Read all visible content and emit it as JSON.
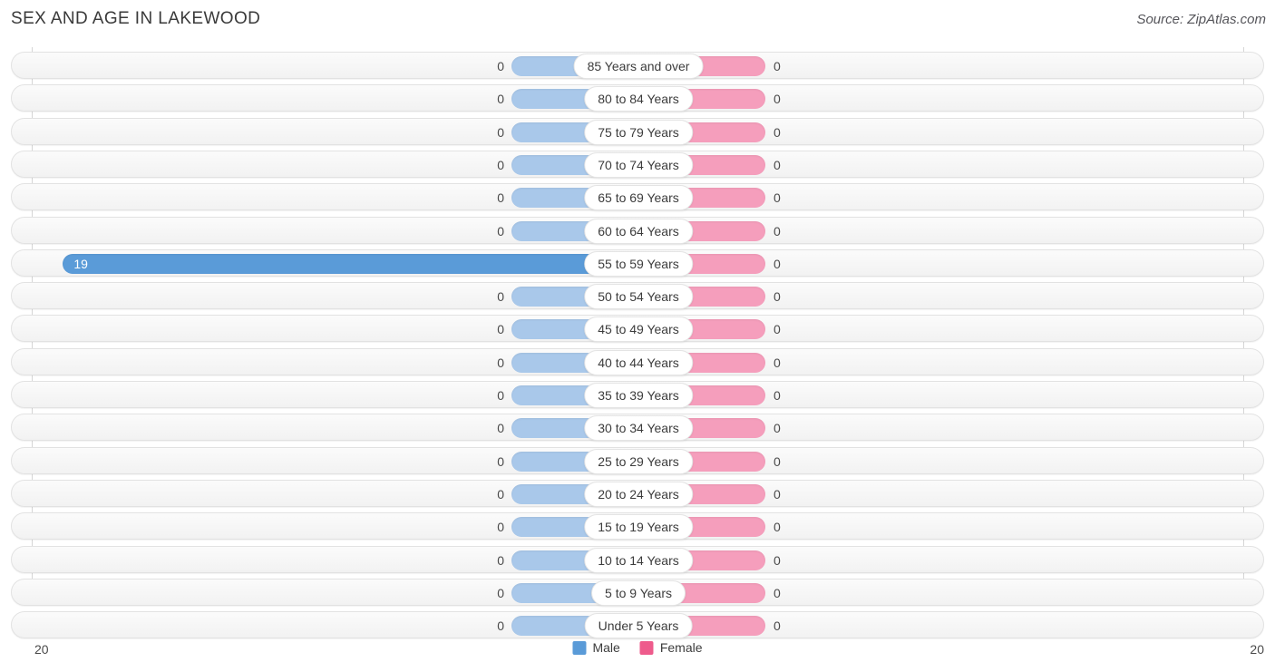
{
  "header": {
    "title": "SEX AND AGE IN LAKEWOOD",
    "source": "Source: ZipAtlas.com"
  },
  "legend": {
    "male_label": "Male",
    "female_label": "Female",
    "male_color": "#5a9bd8",
    "female_color": "#ee5b8c"
  },
  "axis": {
    "left_max_label": "20",
    "right_max_label": "20"
  },
  "chart_data": {
    "type": "bar",
    "subtype": "population-pyramid",
    "title": "SEX AND AGE IN LAKEWOOD",
    "source": "Source: ZipAtlas.com",
    "xlabel": "",
    "ylabel": "",
    "xlim": [
      20,
      20
    ],
    "axis_max": 20,
    "grid": false,
    "legend_position": "bottom-center",
    "categories": [
      "85 Years and over",
      "80 to 84 Years",
      "75 to 79 Years",
      "70 to 74 Years",
      "65 to 69 Years",
      "60 to 64 Years",
      "55 to 59 Years",
      "50 to 54 Years",
      "45 to 49 Years",
      "40 to 44 Years",
      "35 to 39 Years",
      "30 to 34 Years",
      "25 to 29 Years",
      "20 to 24 Years",
      "15 to 19 Years",
      "10 to 14 Years",
      "5 to 9 Years",
      "Under 5 Years"
    ],
    "series": [
      {
        "name": "Male",
        "color": "#5a9bd8",
        "direction": "left",
        "values": [
          0,
          0,
          0,
          0,
          0,
          0,
          19,
          0,
          0,
          0,
          0,
          0,
          0,
          0,
          0,
          0,
          0,
          0
        ]
      },
      {
        "name": "Female",
        "color": "#ee5b8c",
        "direction": "right",
        "values": [
          0,
          0,
          0,
          0,
          0,
          0,
          0,
          0,
          0,
          0,
          0,
          0,
          0,
          0,
          0,
          0,
          0,
          0
        ]
      }
    ],
    "rows": [
      {
        "label": "85 Years and over",
        "male": 0,
        "female": 0,
        "male_text": "0",
        "female_text": "0"
      },
      {
        "label": "80 to 84 Years",
        "male": 0,
        "female": 0,
        "male_text": "0",
        "female_text": "0"
      },
      {
        "label": "75 to 79 Years",
        "male": 0,
        "female": 0,
        "male_text": "0",
        "female_text": "0"
      },
      {
        "label": "70 to 74 Years",
        "male": 0,
        "female": 0,
        "male_text": "0",
        "female_text": "0"
      },
      {
        "label": "65 to 69 Years",
        "male": 0,
        "female": 0,
        "male_text": "0",
        "female_text": "0"
      },
      {
        "label": "60 to 64 Years",
        "male": 0,
        "female": 0,
        "male_text": "0",
        "female_text": "0"
      },
      {
        "label": "55 to 59 Years",
        "male": 19,
        "female": 0,
        "male_text": "19",
        "female_text": "0"
      },
      {
        "label": "50 to 54 Years",
        "male": 0,
        "female": 0,
        "male_text": "0",
        "female_text": "0"
      },
      {
        "label": "45 to 49 Years",
        "male": 0,
        "female": 0,
        "male_text": "0",
        "female_text": "0"
      },
      {
        "label": "40 to 44 Years",
        "male": 0,
        "female": 0,
        "male_text": "0",
        "female_text": "0"
      },
      {
        "label": "35 to 39 Years",
        "male": 0,
        "female": 0,
        "male_text": "0",
        "female_text": "0"
      },
      {
        "label": "30 to 34 Years",
        "male": 0,
        "female": 0,
        "male_text": "0",
        "female_text": "0"
      },
      {
        "label": "25 to 29 Years",
        "male": 0,
        "female": 0,
        "male_text": "0",
        "female_text": "0"
      },
      {
        "label": "20 to 24 Years",
        "male": 0,
        "female": 0,
        "male_text": "0",
        "female_text": "0"
      },
      {
        "label": "15 to 19 Years",
        "male": 0,
        "female": 0,
        "male_text": "0",
        "female_text": "0"
      },
      {
        "label": "10 to 14 Years",
        "male": 0,
        "female": 0,
        "male_text": "0",
        "female_text": "0"
      },
      {
        "label": "5 to 9 Years",
        "male": 0,
        "female": 0,
        "male_text": "0",
        "female_text": "0"
      },
      {
        "label": "Under 5 Years",
        "male": 0,
        "female": 0,
        "male_text": "0",
        "female_text": "0"
      }
    ]
  }
}
